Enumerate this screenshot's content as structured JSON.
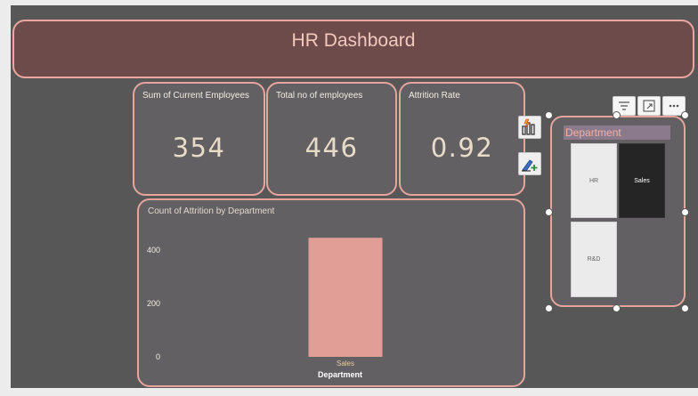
{
  "dashboard": {
    "title": "HR Dashboard"
  },
  "kpis": [
    {
      "label": "Sum of Current Employees",
      "value": "354"
    },
    {
      "label": "Total no of employees",
      "value": "446"
    },
    {
      "label": "Attrition Rate",
      "value": "0.92"
    }
  ],
  "chart_data": {
    "type": "bar",
    "title": "Count of Attrition by Department",
    "categories": [
      "Sales"
    ],
    "values": [
      446
    ],
    "xlabel": "Department",
    "ylabel": "",
    "ylim": [
      0,
      400
    ],
    "yticks": [
      0,
      200,
      400
    ],
    "bar_color": "#e19e97",
    "grid": false
  },
  "slicer": {
    "title": "Department",
    "items": [
      {
        "label": "HR",
        "selected": false
      },
      {
        "label": "Sales",
        "selected": true
      },
      {
        "label": "R&D",
        "selected": false
      }
    ]
  },
  "side_tools": [
    "format-visual-icon",
    "analytics-icon"
  ],
  "visual_toolbar": [
    "filter-icon",
    "focus-mode-icon",
    "more-options-icon"
  ],
  "colors": {
    "canvas": "#575757",
    "header_fill": "#6e4b4b",
    "accent_border": "#e9a7a0",
    "card_fill": "#626063",
    "bar": "#e19e97"
  }
}
